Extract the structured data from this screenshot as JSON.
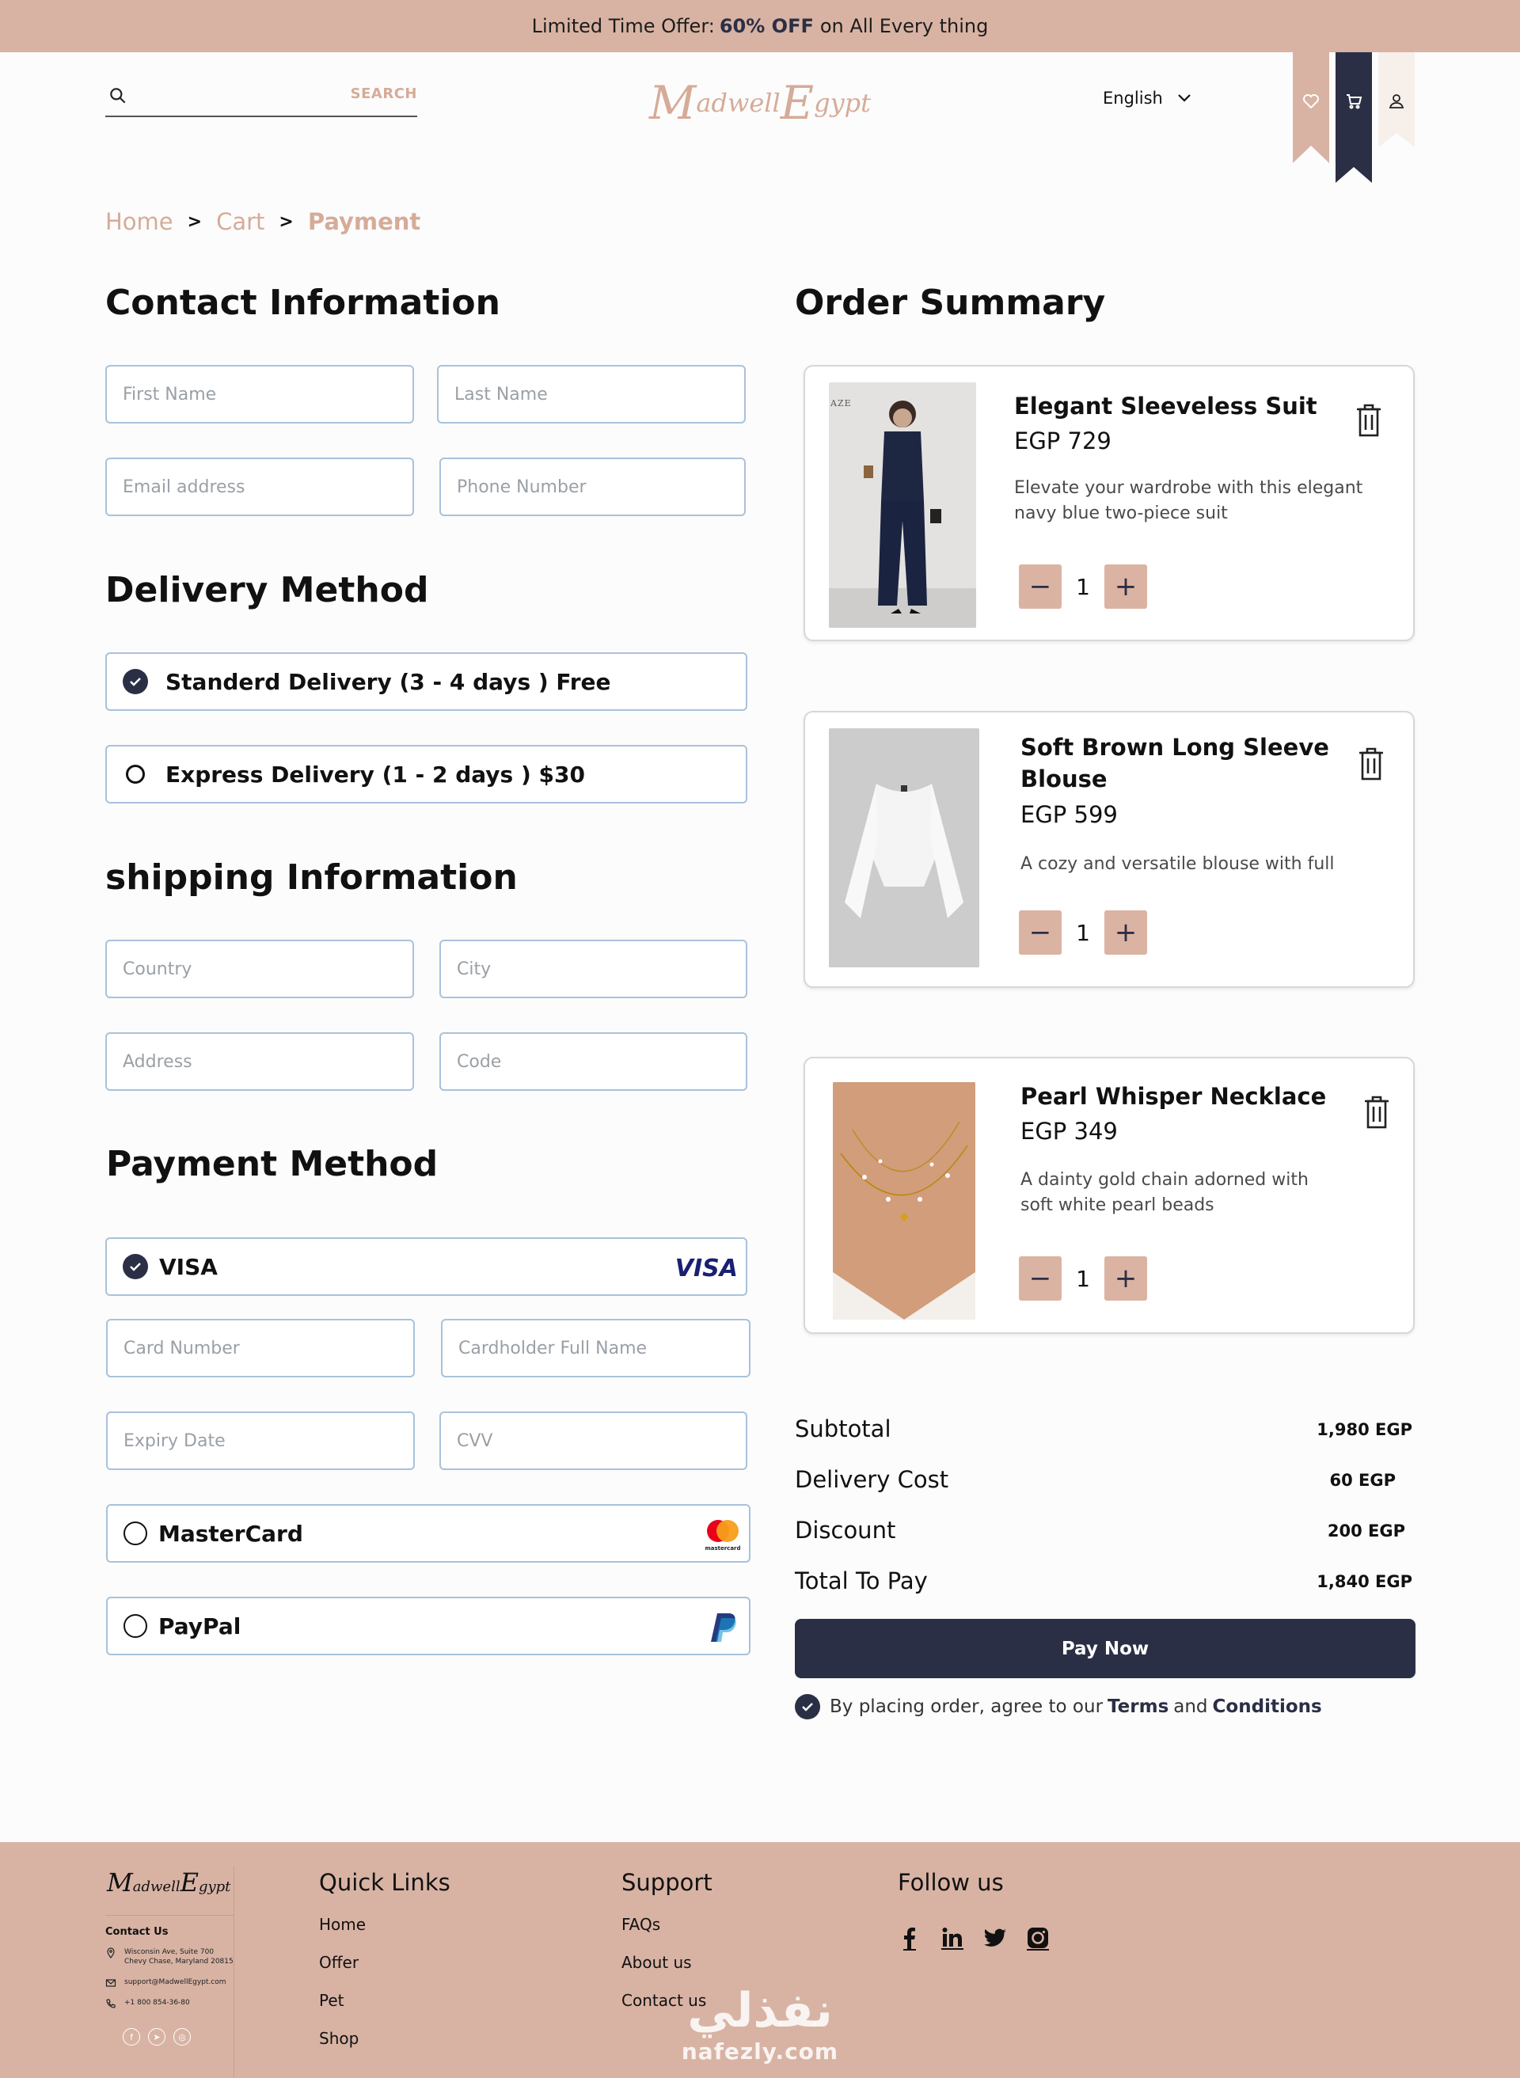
{
  "banner": {
    "prefix": "Limited Time Offer:",
    "highlight": "60% OFF",
    "suffix": "on All Every thing"
  },
  "header": {
    "search_placeholder": "",
    "search_button": "SEARCH",
    "logo_m": "M",
    "logo_mid": "adwell",
    "logo_e": "E",
    "logo_end": "gypt",
    "language": "English",
    "icons": [
      "heart-icon",
      "cart-icon",
      "user-icon"
    ]
  },
  "breadcrumb": {
    "home": "Home",
    "cart": "Cart",
    "current": "Payment"
  },
  "contact": {
    "title": "Contact Information",
    "first_name": "First Name",
    "last_name": "Last Name",
    "email": "Email address",
    "phone": "Phone Number"
  },
  "delivery": {
    "title": "Delivery Method",
    "options": [
      {
        "label": "Standerd Delivery (3 - 4 days ) Free",
        "selected": true
      },
      {
        "label": "Express Delivery (1 - 2 days ) $30",
        "selected": false
      }
    ]
  },
  "shipping": {
    "title": "shipping Information",
    "country": "Country",
    "city": "City",
    "address": "Address",
    "code": "Code"
  },
  "payment": {
    "title": "Payment Method",
    "visa_label": "VISA",
    "visa_logo": "VISA",
    "card_number": "Card Number",
    "cardholder": "Cardholder Full Name",
    "expiry": "Expiry Date",
    "cvv": "CVV",
    "mastercard_label": "MasterCard",
    "mastercard_logo_text": "mastercard",
    "paypal_label": "PayPal"
  },
  "summary": {
    "title": "Order Summary",
    "items": [
      {
        "name": "Elegant Sleeveless  Suit",
        "price": "EGP 729",
        "desc_1": "Elevate your wardrobe with this elegant",
        "desc_2": "navy blue two-piece suit",
        "qty": "1",
        "img_text": "AZE"
      },
      {
        "name_1": "Soft Brown Long Sleeve",
        "name_2": "Blouse",
        "price": "EGP 599",
        "desc_1": "A cozy and versatile blouse with full",
        "qty": "1"
      },
      {
        "name": "Pearl Whisper Necklace",
        "price": "EGP 349",
        "desc_1": "A dainty gold chain adorned with",
        "desc_2": "soft white pearl beads",
        "qty": "1"
      }
    ],
    "minus": "−",
    "plus": "+"
  },
  "totals": {
    "subtotal_label": "Subtotal",
    "subtotal": "1,980 EGP",
    "delivery_label": "Delivery Cost",
    "delivery": "60 EGP",
    "discount_label": "Discount",
    "discount": "200 EGP",
    "total_label": "Total To Pay",
    "total": "1,840 EGP"
  },
  "pay_now": "Pay Now",
  "agree": {
    "prefix": "By placing order, agree to our",
    "terms": "Terms",
    "and": "and",
    "conditions": "Conditions"
  },
  "footer": {
    "logo_m": "M",
    "logo_mid": "adwell",
    "logo_e": "E",
    "logo_end": "gypt",
    "contact_title": "Contact Us",
    "address_1": "Wisconsin Ave, Suite 700",
    "address_2": "Chevy Chase, Maryland 20815",
    "email": "support@MadwellEgypt.com",
    "phone": "+1 800 854-36-80",
    "quick_links_title": "Quick Links",
    "quick_links": [
      "Home",
      "Offer",
      "Pet",
      "Shop"
    ],
    "support_title": "Support",
    "support_links": [
      "FAQs",
      "About us",
      "Contact us"
    ],
    "follow_title": "Follow us"
  },
  "watermark": {
    "arabic": "نفذلي",
    "latin": "nafezly.com"
  },
  "colors": {
    "accent": "#d8b3a3",
    "navy": "#2b2f45",
    "border": "#a9c2da"
  }
}
